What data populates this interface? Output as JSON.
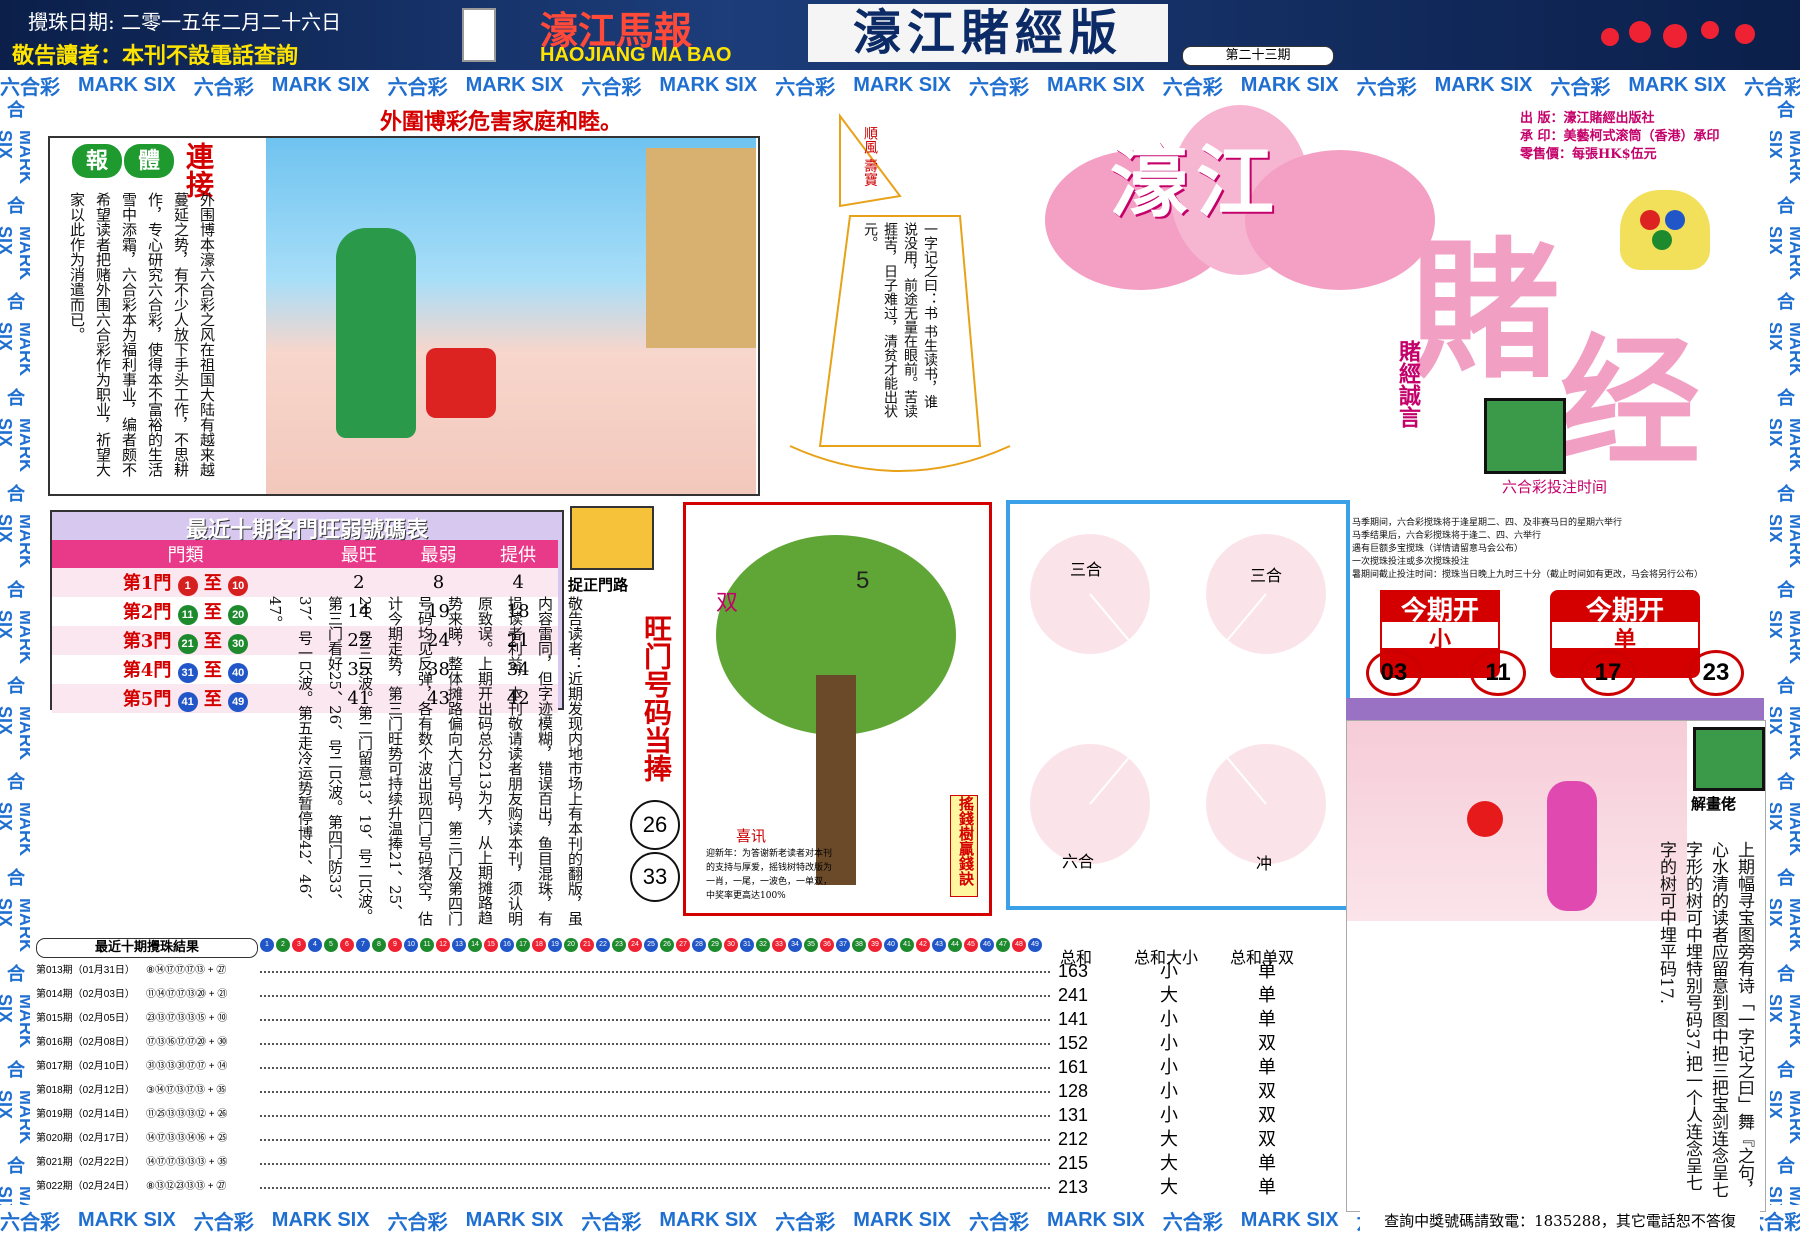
{
  "header": {
    "date_line": "攪珠日期: 二零一五年二月二十六日",
    "notice": "敬告讀者：本刊不設電話查詢",
    "logo_cn": "濠江馬報",
    "logo_en": "HAOJIANG MA BAO",
    "edition": "濠江賭經版",
    "issue": "第二十三期"
  },
  "band_text": [
    "六合彩",
    "MARK SIX"
  ],
  "headline": "外圍博彩危害家庭和睦。",
  "serial": {
    "tag1": "報",
    "tag2": "體",
    "tag3": "連接",
    "body": "外围博本濠六合彩之风在祖国大陆有越来越蔓延之势，有不少人放下手头工作，不思耕作，专心研究六合彩，使得本不富裕的生活雪中添霜，六合彩本为福利事业，编者颇不希望读者把赌外围六合彩作为职业，祈望大家以此作为消遣而已。"
  },
  "boat": {
    "sail": "順風 壽寶",
    "poem": "一字记之曰：书 书生读书，谁说没用，前途无量在眼前。苦读捱苦，日子难过，清贫才能出状元。"
  },
  "masthead": {
    "pub_label": "出 版：",
    "pub": "濠江賭經出版社",
    "print_label": "承 印：",
    "print": "美藝柯式滚筒（香港）承印",
    "price_label": "零售價：",
    "price": "每張HK$伍元",
    "title1": "濠江",
    "title2": "賭",
    "title3": "经",
    "slogan": "賭經誠言",
    "schedule_title": "六合彩投注时间",
    "schedule": [
      "马季期间，六合彩搅珠将于逢星期二、四、及非赛马日的星期六举行",
      "马季结果后，六合彩搅珠将于逢二、四、六举行",
      "遇有巨额多宝搅珠（详情请留意马会公布）",
      "一次搅珠投注或多次搅珠投注",
      "暑期间截止投注时间：搅珠当日晚上九时三十分（截止时间如有更改，马会将另行公布）"
    ]
  },
  "ten_table": {
    "title": "最近十期各門旺弱號碼表",
    "headers": [
      "門類",
      "最旺",
      "最弱",
      "提供"
    ],
    "rows": [
      {
        "door": "第1門",
        "from": "1",
        "to": "10",
        "hot": "2",
        "cold": "8",
        "tip": "4",
        "color": "#d62020"
      },
      {
        "door": "第2門",
        "from": "11",
        "to": "20",
        "hot": "14",
        "cold": "19",
        "tip": "18",
        "color": "#1e8a2e"
      },
      {
        "door": "第3門",
        "from": "21",
        "to": "30",
        "hot": "22",
        "cold": "24",
        "tip": "21",
        "color": "#1e8a2e"
      },
      {
        "door": "第4門",
        "from": "31",
        "to": "40",
        "hot": "35",
        "cold": "38",
        "tip": "34",
        "color": "#2156c9"
      },
      {
        "door": "第5門",
        "from": "41",
        "to": "49",
        "hot": "41",
        "cold": "43",
        "tip": "42",
        "color": "#2156c9"
      }
    ]
  },
  "catch_door": {
    "label": "捉正門路",
    "notice": "敬告读者：近期发现内地市场上有本刊的翻版，虽内容雷同，但字迹模糊，错误百出，鱼目混珠，有损读者利益，本刊敬请读者朋友购读本刊，须认明原致误。上期开出码总分213为大，从上期摊路趋势来睇，整体摊路偏向大门号码，第三门及第四门号码均见反弹，各有数个波出现四门号码落空，估计今期走势，第三门旺势可持续升温捧21、25、28、号三只波。第二门留意13、19、号二只波。第三门看好25、26、号二只波。第四门防33、37、号一只波。第五走冷运势暂停博42、46、47。",
    "hot_title": "旺门号码当捧",
    "hot_nums": [
      "26",
      "33"
    ]
  },
  "tree": {
    "title": "喜讯",
    "body": "迎新年：为答谢新老读者对本刊的支持与厚爱，摇钱树特改版为一肖，一尾，一波色，一单双，中奖率更高达100%",
    "left_tag": "双",
    "right_tag": "5",
    "side": "搖錢樹贏錢訣"
  },
  "zodiac": {
    "tl": "三合",
    "tr": "三合",
    "bl": "六合",
    "br": "冲"
  },
  "this_issue": {
    "title1": "今期开",
    "val1": "小",
    "title2": "今期开",
    "val2": "单",
    "nums": [
      "03",
      "11",
      "17",
      "23"
    ]
  },
  "explain": {
    "label": "解畫佬",
    "body": "上期幅寻宝图旁有诗「一字记之曰」舞『之句，心水清的读者应留意到图中把三把宝剑连念呈七字形的树可中埋特别号码37.把一个人连念呈七字的树可中埋平码17."
  },
  "results": {
    "title": "最近十期攪珠結果",
    "col_sum": "总和",
    "col_bigsmall": "总和大小",
    "col_oddeven": "总和单双",
    "rows": [
      {
        "label": "第013期（01月31日）",
        "balls": "⑧⑭⑰⑰⑰⑬ + ㉗",
        "sum": "163",
        "bs": "小",
        "oe": "单"
      },
      {
        "label": "第014期（02月03日）",
        "balls": "⑪⑭⑰⑰⑬⑳ + ㉑",
        "sum": "241",
        "bs": "大",
        "oe": "单"
      },
      {
        "label": "第015期（02月05日）",
        "balls": "㉓⑬⑰⑬⑬⑮ + ⑩",
        "sum": "141",
        "bs": "小",
        "oe": "单"
      },
      {
        "label": "第016期（02月08日）",
        "balls": "⑰⑬⑯⑰⑰⑳ + ㉚",
        "sum": "152",
        "bs": "小",
        "oe": "双"
      },
      {
        "label": "第017期（02月10日）",
        "balls": "㉛⑬⑬㉛⑰⑰ + ⑭",
        "sum": "161",
        "bs": "小",
        "oe": "单"
      },
      {
        "label": "第018期（02月12日）",
        "balls": "③⑭⑰⑬⑰⑬ + ㉟",
        "sum": "128",
        "bs": "小",
        "oe": "双"
      },
      {
        "label": "第019期（02月14日）",
        "balls": "⑪㉕⑬⑬⑬⑫ + ㉖",
        "sum": "131",
        "bs": "小",
        "oe": "双"
      },
      {
        "label": "第020期（02月17日）",
        "balls": "⑭⑰⑬⑬⑭⑯ + ㉕",
        "sum": "212",
        "bs": "大",
        "oe": "双"
      },
      {
        "label": "第021期（02月22日）",
        "balls": "⑭⑰⑰⑬⑬⑬ + ㉟",
        "sum": "215",
        "bs": "大",
        "oe": "单"
      },
      {
        "label": "第022期（02月24日）",
        "balls": "⑧⑬⑫㉓⑬⑬ + ㉗",
        "sum": "213",
        "bs": "大",
        "oe": "单"
      }
    ]
  },
  "footer": "查詢中獎號碼請致電：1835288，其它電話恕不答復",
  "colors": {
    "accent": "#c4006a",
    "red": "#d40000",
    "blue": "#1f6fd1"
  }
}
